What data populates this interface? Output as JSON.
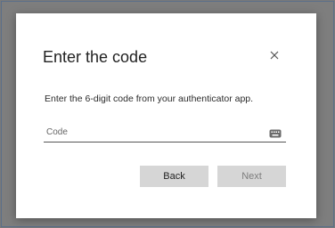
{
  "dialog": {
    "title": "Enter the code",
    "description": "Enter the 6-digit code from your authenticator app.",
    "code_field": {
      "placeholder": "Code",
      "value": ""
    },
    "back_label": "Back",
    "next_label": "Next",
    "icons": {
      "close": "close-icon",
      "keyboard": "keyboard-icon"
    }
  },
  "colors": {
    "backdrop": "#7e7e7e",
    "dialog_bg": "#ffffff",
    "button_bg": "#d6d6d6",
    "disabled_text": "#7d7d7d"
  }
}
